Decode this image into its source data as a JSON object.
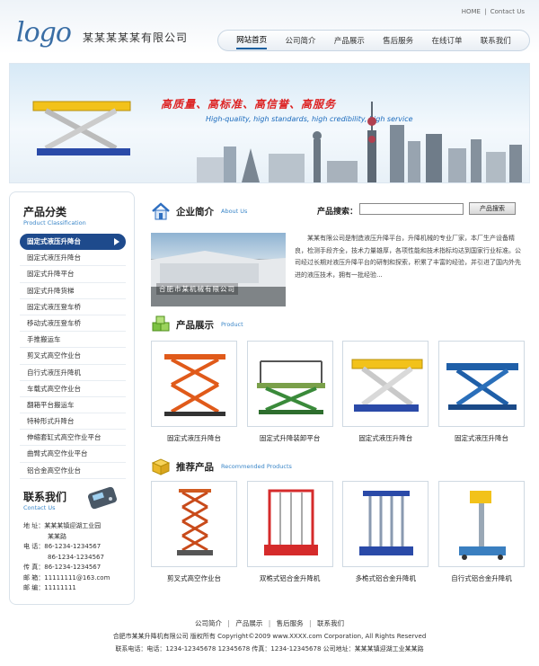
{
  "topbar": {
    "home": "HOME",
    "sep": "|",
    "contact": "Contact Us"
  },
  "logo": "logo",
  "company_name": "某某某某某有限公司",
  "nav": [
    "网站首页",
    "公司简介",
    "产品展示",
    "售后服务",
    "在线订单",
    "联系我们"
  ],
  "banner": {
    "slogan": "高质量、高标准、高信誉、高服务",
    "slogan_en": "High-quality, high standards, high credibility, high service"
  },
  "sidebar": {
    "title": "产品分类",
    "subtitle": "Product Classification",
    "categories": [
      "固定式液压升降台",
      "固定式液压升降台",
      "固定式升降平台",
      "固定式升降货梯",
      "固定式液压登车桥",
      "移动式液压登车桥",
      "手推搬运车",
      "剪叉式高空作业台",
      "自行式液压升降机",
      "车载式高空作业台",
      "翻箱平台搬运车",
      "特种形式升降台",
      "伸缩套缸式高空作业平台",
      "曲臂式高空作业平台",
      "铝合金高空作业台"
    ],
    "contact_title": "联系我们",
    "contact_sub": "Contact Us",
    "contact": {
      "address_label": "地  址：",
      "address_1": "某某某镇迎湖工业园",
      "address_2": "某某路",
      "tel_label": "电  话：",
      "tel_1": "86-1234-1234567",
      "tel_2": "86-1234-1234567",
      "fax_label": "传  真：",
      "fax": "86-1234-1234567",
      "email_label": "邮  箱：",
      "email": "11111111@163.com",
      "zip_label": "邮  编：",
      "zip": "11111111"
    }
  },
  "search": {
    "label": "产品搜索：",
    "value": "",
    "button": "产品搜索"
  },
  "about": {
    "title": "企业简介",
    "subtitle": "About Us",
    "photo_caption": "合肥市某机械有限公司",
    "text": "某某有限公司是制造液压升降平台，升降机械的专业厂家，本厂生产设备精良，检测手段齐全，技术力量雄厚，各项性能和技术指标均达到国家行业标准。公司经过长期对液压升降平台的研制和探索，积累了丰富的经验，并引进了国内外先进的液压技术，拥有一批经验..."
  },
  "products": {
    "title": "产品展示",
    "subtitle": "Product",
    "items": [
      "固定式液压升降台",
      "固定式升降装卸平台",
      "固定式液压升降台",
      "固定式液压升降台"
    ]
  },
  "recommended": {
    "title": "推荐产品",
    "subtitle": "Recommended Products",
    "items": [
      "剪叉式高空作业台",
      "双桅式铝合金升降机",
      "多桅式铝合金升降机",
      "自行式铝合金升降机"
    ]
  },
  "footer": {
    "links": [
      "公司简介",
      "产品展示",
      "售后服务",
      "联系我们"
    ],
    "link_sep": "|",
    "copyright": "合肥市某某升降机有限公司 版权所有 Copyright©2009 www.XXXX.com Corporation, All Rights Reserved",
    "contact_line": "联系电话：电话：1234-12345678 12345678 传真：1234-12345678 公司地址：某某某镇迎湖工业某某路"
  },
  "colors": {
    "accent": "#1e4a8c",
    "link_blue": "#3a86c8",
    "slogan_red": "#dd2222"
  }
}
